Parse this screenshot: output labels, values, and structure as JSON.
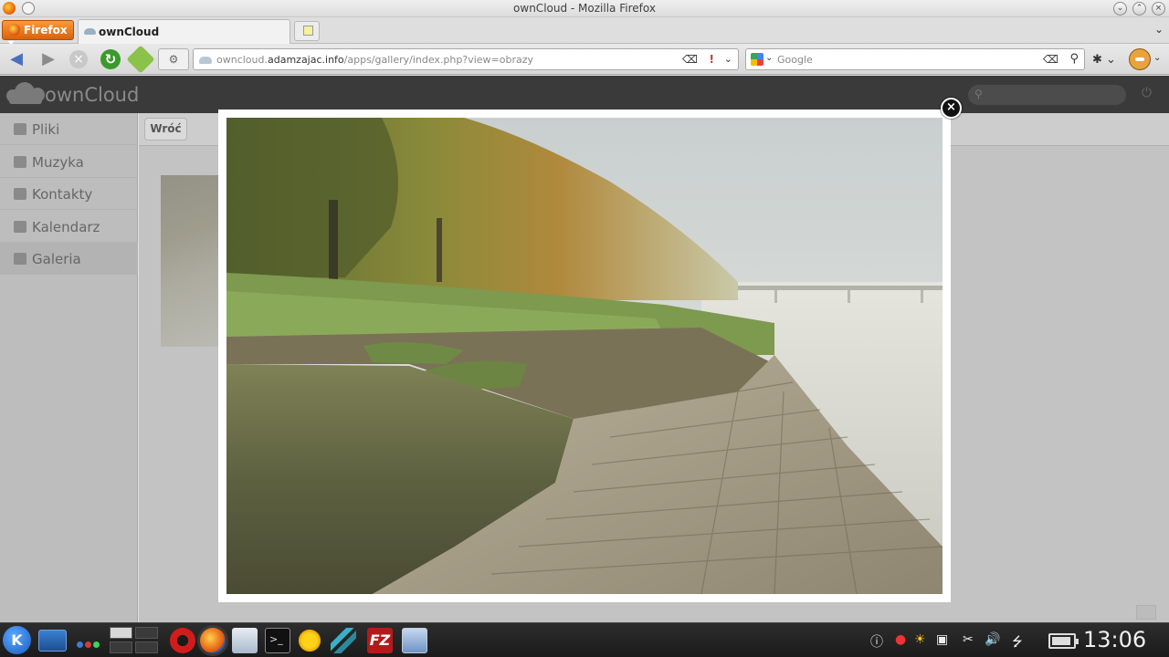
{
  "window": {
    "title": "ownCloud - Mozilla Firefox"
  },
  "firefox_menu": {
    "label": "Firefox"
  },
  "tabs": [
    {
      "label": "ownCloud"
    }
  ],
  "navbar": {
    "url_host_prefix": "owncloud.",
    "url_host": "adamzajac.info",
    "url_path": "/apps/gallery/index.php?view=obrazy",
    "search_placeholder": "Google"
  },
  "app": {
    "brand": "ownCloud",
    "nav": [
      {
        "label": "Pliki",
        "icon": "file-icon"
      },
      {
        "label": "Muzyka",
        "icon": "music-note-icon"
      },
      {
        "label": "Kontakty",
        "icon": "contacts-icon"
      },
      {
        "label": "Kalendarz",
        "icon": "calendar-icon"
      },
      {
        "label": "Galeria",
        "icon": "gallery-icon",
        "active": true
      }
    ],
    "back_label": "Wróć"
  },
  "lightbox": {
    "close_glyph": "×",
    "image_subject": "misty river bank with stone embankment and autumn trees"
  },
  "taskbar": {
    "clock": "13:06",
    "fz_label": "FZ"
  },
  "colors": {
    "app_header": "#3a3a3a",
    "sidebar": "#bdbdbd",
    "firefox_orange": "#e0640f",
    "taskbar": "#222222"
  }
}
